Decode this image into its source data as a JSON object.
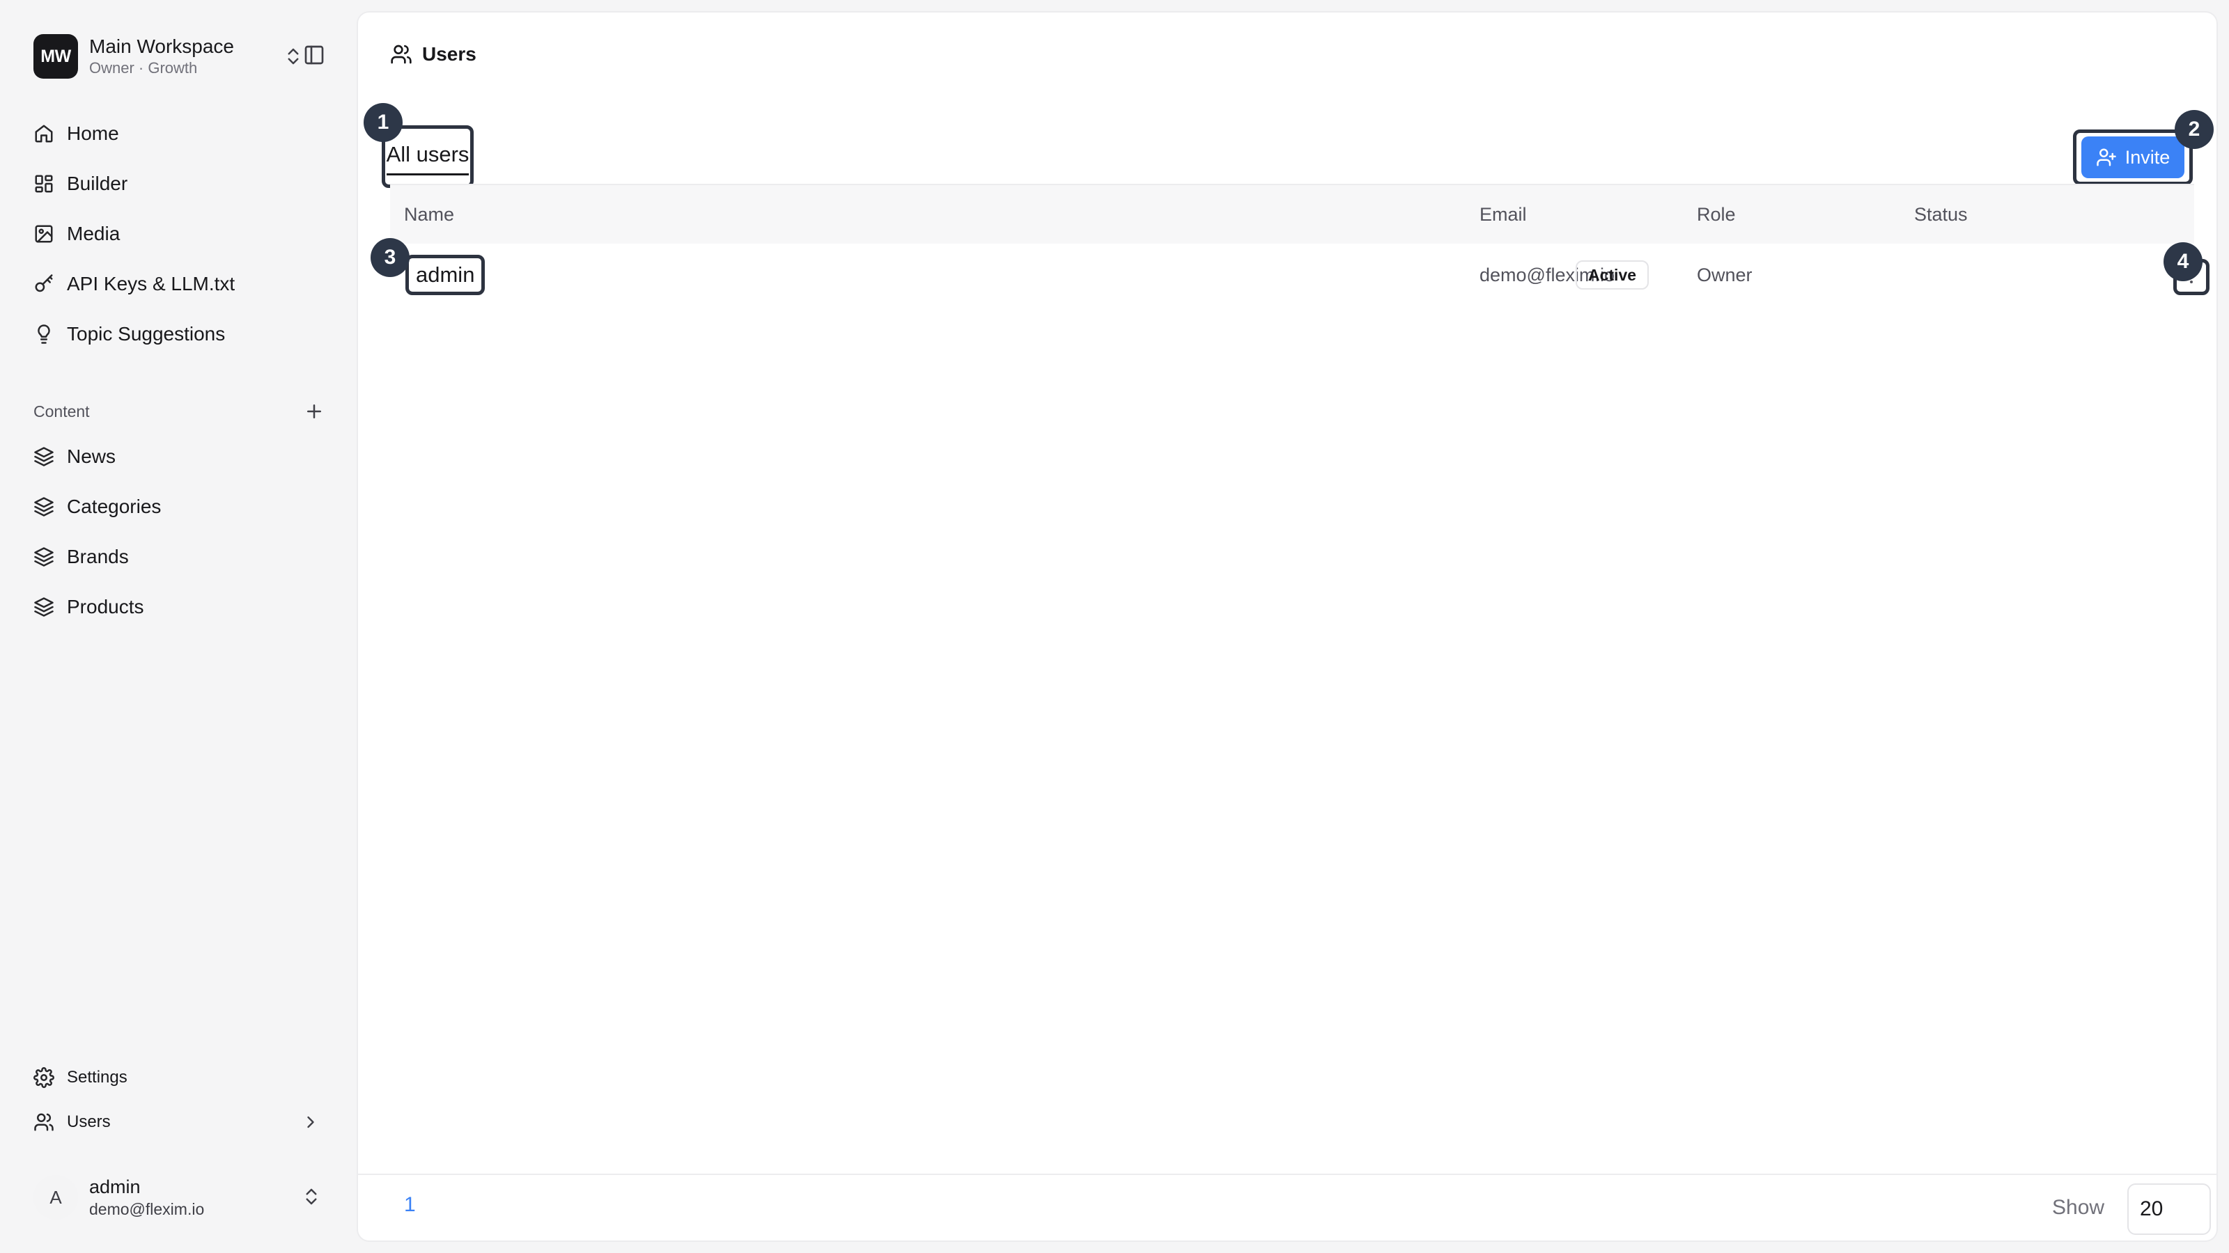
{
  "workspace": {
    "initials": "MW",
    "name": "Main Workspace",
    "subtitle": "Owner · Growth"
  },
  "sidebar": {
    "nav": [
      {
        "label": "Home",
        "icon": "home-icon"
      },
      {
        "label": "Builder",
        "icon": "grid-icon"
      },
      {
        "label": "Media",
        "icon": "image-icon"
      },
      {
        "label": "API Keys & LLM.txt",
        "icon": "key-icon"
      },
      {
        "label": "Topic Suggestions",
        "icon": "lightbulb-icon"
      }
    ],
    "content_section": "Content",
    "content_items": [
      {
        "label": "News",
        "icon": "layers-icon"
      },
      {
        "label": "Categories",
        "icon": "layers-icon"
      },
      {
        "label": "Brands",
        "icon": "layers-icon"
      },
      {
        "label": "Products",
        "icon": "layers-icon"
      }
    ],
    "bottom": [
      {
        "label": "Settings",
        "icon": "gear-icon"
      },
      {
        "label": "Users",
        "icon": "users-icon"
      }
    ],
    "user": {
      "initial": "A",
      "name": "admin",
      "email": "demo@flexim.io"
    }
  },
  "main": {
    "title": "Users",
    "tab": "All users",
    "invite_label": "Invite",
    "columns": [
      "Name",
      "Email",
      "Role",
      "Status"
    ],
    "rows": [
      {
        "name": "admin",
        "email": "demo@flexim.io",
        "role": "Owner",
        "status": "Active"
      }
    ],
    "markers": [
      "1",
      "2",
      "3",
      "4"
    ],
    "footer": {
      "page": "1",
      "show_label": "Show",
      "page_size": "20"
    }
  },
  "colors": {
    "accent": "#3b82f6",
    "marker": "#2d3748",
    "logo_bg": "#18181b"
  }
}
